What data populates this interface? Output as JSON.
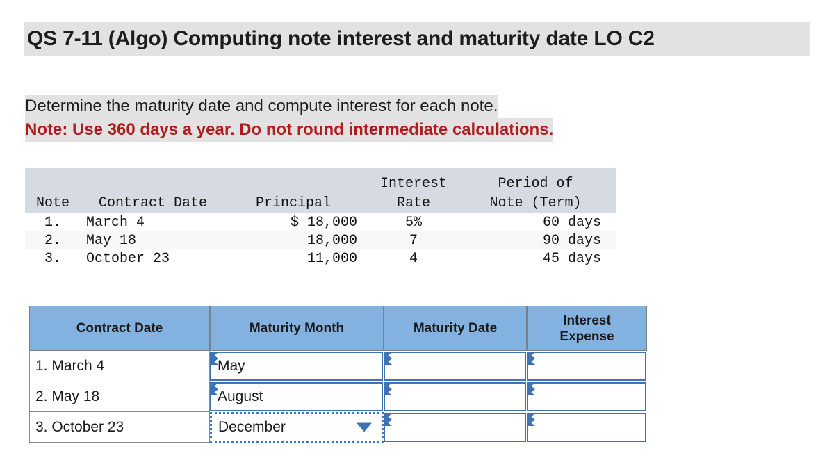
{
  "title": "QS 7-11 (Algo) Computing note interest and maturity date LO C2",
  "instructions": {
    "line1": "Determine the maturity date and compute interest for each note.",
    "line2": "Note: Use 360 days a year. Do not round intermediate calculations.",
    "note_color": "#b01c1c"
  },
  "note_table": {
    "header_top": {
      "interest": "Interest",
      "period": "Period of"
    },
    "headers": {
      "note": "Note",
      "contract_date": "Contract Date",
      "principal": "Principal",
      "rate": "Rate",
      "term": "Note (Term)"
    },
    "rows": [
      {
        "note": "1.",
        "contract_date": "March 4",
        "principal": "$ 18,000",
        "rate": "5%",
        "term": "60 days"
      },
      {
        "note": "2.",
        "contract_date": "May 18",
        "principal": "18,000",
        "rate": "7",
        "term": "90 days"
      },
      {
        "note": "3.",
        "contract_date": "October 23",
        "principal": "11,000",
        "rate": "4",
        "term": "45 days"
      }
    ]
  },
  "answer_table": {
    "header_bg": "#84b2e0",
    "headers": {
      "contract_date": "Contract Date",
      "maturity_month": "Maturity Month",
      "maturity_date": "Maturity Date",
      "interest_expense_line1": "Interest",
      "interest_expense_line2": "Expense"
    },
    "rows": [
      {
        "label": "1. March 4",
        "maturity_month": "May",
        "maturity_date": "",
        "interest_expense": ""
      },
      {
        "label": "2. May 18",
        "maturity_month": "August",
        "maturity_date": "",
        "interest_expense": ""
      },
      {
        "label": "3. October 23",
        "maturity_month": "December",
        "maturity_date": "",
        "interest_expense": ""
      }
    ]
  }
}
